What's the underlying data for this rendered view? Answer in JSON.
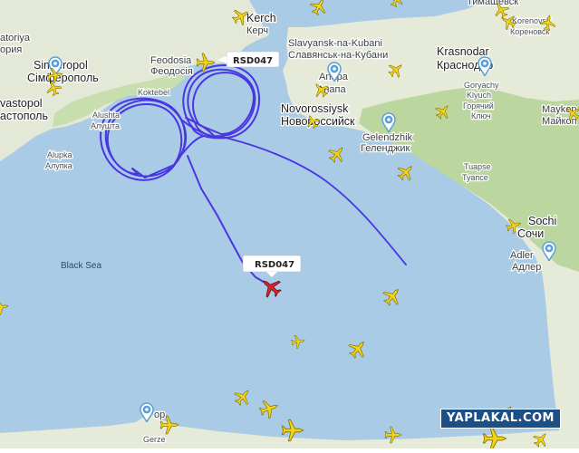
{
  "map": {
    "sea_label": "Black Sea",
    "colors": {
      "sea": "#a9cbe6",
      "land_green": "#bfd8a2",
      "land_light": "#e6ead9",
      "track": "#4a36e0",
      "aircraft": "#f5d416",
      "tracked_aircraft": "#d8242c",
      "airport_pin": "#5aa0d8"
    },
    "tracked_flight": {
      "callsign": "RSD047",
      "start_label": "RSD047"
    },
    "places": [
      {
        "id": "kerch",
        "text": "Kerch"
      },
      {
        "id": "kerch-cyr",
        "text": "Керч"
      },
      {
        "id": "timashevsk",
        "text": "Тимашевск"
      },
      {
        "id": "korenovsk",
        "text": "Korenovsk"
      },
      {
        "id": "korenovsk-cyr",
        "text": "Кореновск"
      },
      {
        "id": "krasnodar",
        "text": "Krasnodar"
      },
      {
        "id": "krasnodar-cyr",
        "text": "Краснодар"
      },
      {
        "id": "slavyansk",
        "text": "Slavyansk-na-Kubani"
      },
      {
        "id": "slavyansk-cyr",
        "text": "Славянськ-на-Кубани"
      },
      {
        "id": "feodosia",
        "text": "Feodosia"
      },
      {
        "id": "feodosia-cyr",
        "text": "Феодосія"
      },
      {
        "id": "anapa",
        "text": "Anapa"
      },
      {
        "id": "anapa-cyr",
        "text": "Анапа"
      },
      {
        "id": "novorossiysk",
        "text": "Novorossiysk"
      },
      {
        "id": "novorossiysk-cyr",
        "text": "Новороссийск"
      },
      {
        "id": "koktebel",
        "text": "Koktebel"
      },
      {
        "id": "alushta",
        "text": "Alushta"
      },
      {
        "id": "alushta-cyr",
        "text": "Алушта"
      },
      {
        "id": "gelendzhik",
        "text": "Gelendzhik"
      },
      {
        "id": "gelendzhik-cyr",
        "text": "Геленджик"
      },
      {
        "id": "goryachy",
        "text": "Goryachy"
      },
      {
        "id": "goryachy2",
        "text": "Klyuch"
      },
      {
        "id": "goryachy-cyr",
        "text": "Горячий"
      },
      {
        "id": "klyuch-cyr",
        "text": "Ключ"
      },
      {
        "id": "maykop",
        "text": "Maykop"
      },
      {
        "id": "maykop-cyr",
        "text": "Майкоп"
      },
      {
        "id": "tuapse",
        "text": "Tuapse"
      },
      {
        "id": "tuapse-cyr",
        "text": "Туапсе"
      },
      {
        "id": "sochi",
        "text": "Sochi"
      },
      {
        "id": "sochi-cyr",
        "text": "Сочи"
      },
      {
        "id": "adler",
        "text": "Adler"
      },
      {
        "id": "adler-cyr",
        "text": "Адлер"
      },
      {
        "id": "simferopol",
        "text": "Simferopol"
      },
      {
        "id": "simferopol-cyr",
        "text": "Сімферополь"
      },
      {
        "id": "sevastopol",
        "text": "vastopol"
      },
      {
        "id": "sevastopol-cyr",
        "text": "астополь"
      },
      {
        "id": "dzhankoy",
        "text": "atoriya"
      },
      {
        "id": "evpatoriya-cyr",
        "text": "ория"
      },
      {
        "id": "alupka",
        "text": "Alupka"
      },
      {
        "id": "alupka-cyr",
        "text": "Алупка"
      },
      {
        "id": "gerze",
        "text": "Gerze"
      },
      {
        "id": "sinop",
        "text": "op"
      }
    ]
  },
  "watermark": "YAPLAKAL.COM"
}
